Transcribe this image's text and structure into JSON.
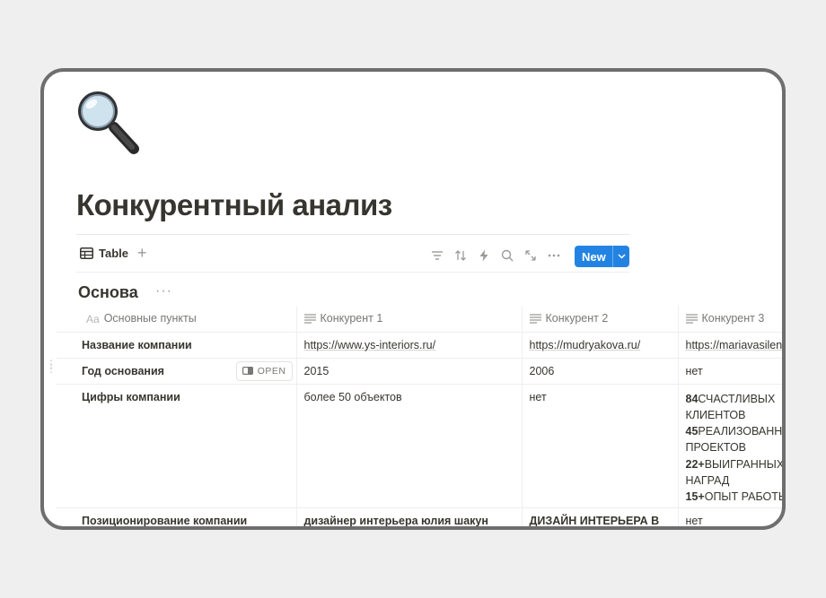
{
  "page": {
    "icon": "magnifying-glass",
    "title": "Конкурентный анализ"
  },
  "toolbar": {
    "view_label": "Table",
    "add_view": "+",
    "new_label": "New",
    "tools": [
      "filter-icon",
      "sort-icon",
      "lightning-icon",
      "search-icon",
      "expand-icon",
      "more-icon"
    ]
  },
  "group": {
    "title": "Основа",
    "more": "···"
  },
  "table": {
    "headers": [
      {
        "icon": "Aa",
        "label": "Основные пункты"
      },
      {
        "icon": "text-lines-icon",
        "label": "Конкурент 1"
      },
      {
        "icon": "text-lines-icon",
        "label": "Конкурент 2"
      },
      {
        "icon": "text-lines-icon",
        "label": "Конкурент 3"
      }
    ],
    "open_label": "OPEN",
    "rows": [
      {
        "name": "Название компании",
        "c1": "https://www.ys-interiors.ru/",
        "c2": "https://mudryakova.ru/",
        "c3": "https://mariavasilenko"
      },
      {
        "name": "Год основания",
        "c1": "2015",
        "c2": "2006",
        "c3": "нет"
      },
      {
        "name": "Цифры компании",
        "c1": "более 50 объектов",
        "c2": "нет",
        "c3_lines": [
          {
            "num": "84",
            "text": "СЧАСТЛИВЫХ"
          },
          {
            "num": "",
            "text": "КЛИЕНТОВ"
          },
          {
            "num": "45",
            "text": "РЕАЛИЗОВАННЫХ"
          },
          {
            "num": "",
            "text": "ПРОЕКТОВ"
          },
          {
            "num": "22+",
            "text": "ВЫИГРАННЫХ"
          },
          {
            "num": "",
            "text": "НАГРАД"
          },
          {
            "num": "15+",
            "text": "ОПЫТ РАБОТЫ"
          }
        ]
      },
      {
        "name": "Позиционирование компании",
        "c1": "дизайнер интерьера юлия шакун",
        "c2": "ДИЗАЙН ИНТЕРЬЕРА В",
        "c3": "нет"
      }
    ]
  },
  "colors": {
    "accent": "#2383e2",
    "text": "#37352f",
    "muted": "#787774",
    "frame": "#6e6e6e",
    "background": "#efefef"
  }
}
